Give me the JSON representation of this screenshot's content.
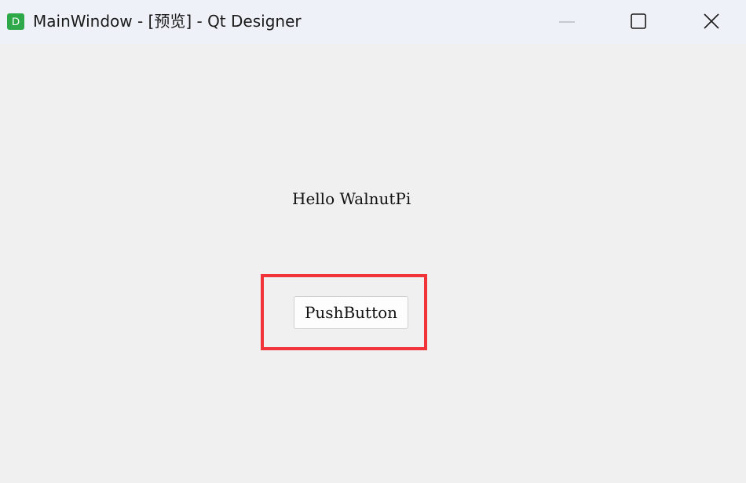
{
  "window": {
    "icon_letter": "D",
    "title": "MainWindow - [预览] - Qt Designer",
    "controls": {
      "minimize_icon": "minimize-icon",
      "maximize_icon": "maximize-icon",
      "close_icon": "close-icon"
    }
  },
  "form": {
    "label_text": "Hello WalnutPi",
    "button_label": "PushButton"
  },
  "annotation": {
    "highlight_color": "#f0343a"
  },
  "colors": {
    "app_icon": "#2fa84a",
    "titlebar_bg": "#eef2f8",
    "client_bg": "#f0f0f0"
  }
}
